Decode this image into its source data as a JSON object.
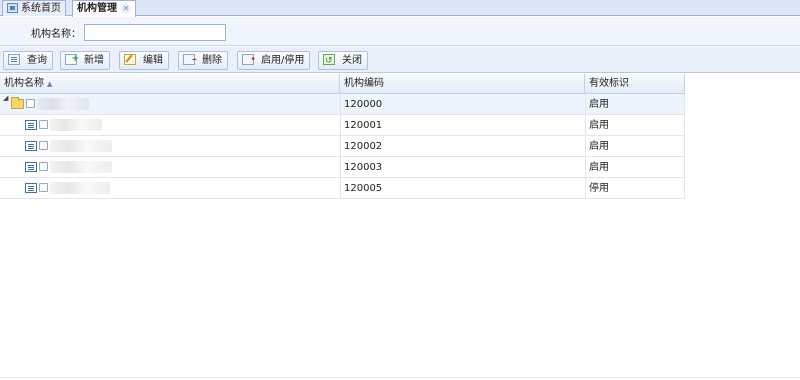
{
  "tabs": [
    {
      "label": "系统首页",
      "active": false
    },
    {
      "label": "机构管理",
      "active": true
    }
  ],
  "search": {
    "label": "机构名称：",
    "value": "",
    "placeholder": ""
  },
  "toolbar": {
    "query": "查询",
    "add": "新增",
    "edit": "编辑",
    "delete": "删除",
    "toggle": "启用/停用",
    "close": "关闭"
  },
  "grid": {
    "columns": [
      "机构名称",
      "机构编码",
      "有效标识"
    ],
    "sort": "ascending",
    "rows": [
      {
        "code": "120000",
        "flag": "启用",
        "level": 0,
        "expanded": true
      },
      {
        "code": "120001",
        "flag": "启用",
        "level": 1
      },
      {
        "code": "120002",
        "flag": "启用",
        "level": 1
      },
      {
        "code": "120003",
        "flag": "启用",
        "level": 1
      },
      {
        "code": "120005",
        "flag": "停用",
        "level": 1
      }
    ]
  },
  "colors": {
    "tab_bar": "#dde7f5",
    "panel": "#f0f5fb",
    "border": "#9bb4d6"
  }
}
